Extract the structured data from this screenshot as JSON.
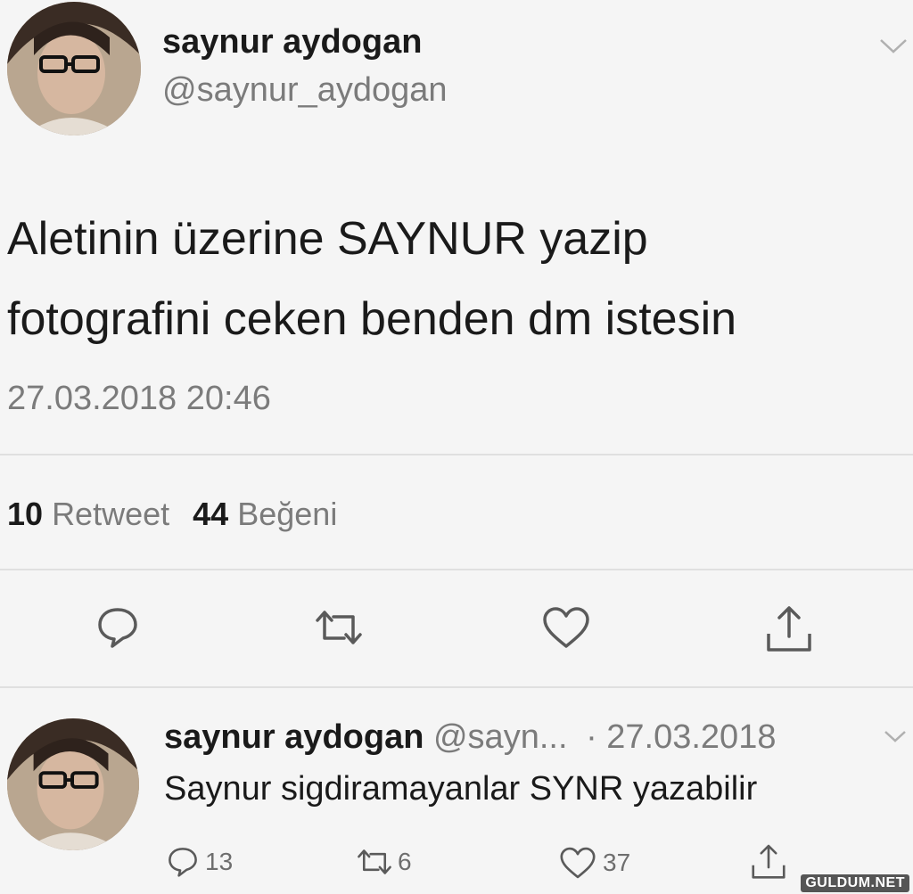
{
  "main_tweet": {
    "display_name": "saynur aydogan",
    "handle": "@saynur_aydogan",
    "text_line1": "Aletinin üzerine SAYNUR yazip",
    "text_line2": "fotografini ceken benden dm istesin",
    "timestamp": "27.03.2018 20:46",
    "retweet_count": "10",
    "retweet_label": "Retweet",
    "like_count": "44",
    "like_label": "Beğeni"
  },
  "reply_tweet": {
    "display_name": "saynur aydogan",
    "handle": "@sayn...",
    "date": "· 27.03.2018",
    "text": "Saynur sigdiramayanlar SYNR yazabilir",
    "reply_count": "13",
    "retweet_count": "6",
    "like_count": "37"
  },
  "watermark": "GULDUM.NET",
  "icons": [
    "chevron-down-icon",
    "reply-icon",
    "retweet-icon",
    "like-icon",
    "share-icon"
  ],
  "colors": {
    "background": "#f5f5f5",
    "text": "#1c1c1c",
    "muted": "#7b7b7b",
    "divider": "#e0e0e0"
  }
}
